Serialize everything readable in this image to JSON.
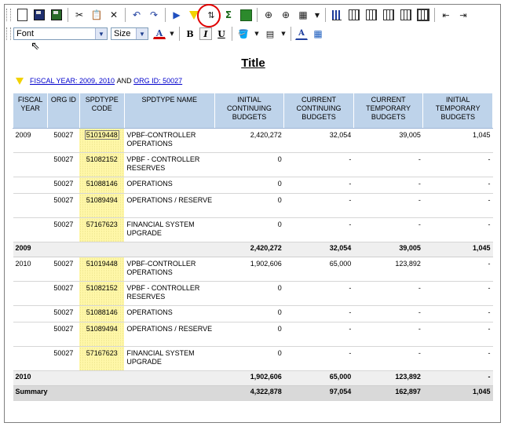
{
  "toolbar": {
    "tools": [
      "new",
      "save",
      "save-all",
      "cut",
      "paste",
      "delete",
      "undo",
      "redo",
      "run",
      "filter",
      "sort",
      "sum",
      "grid",
      "insert-row",
      "insert-col",
      "more",
      "chart",
      "table-a",
      "table-b",
      "table-c",
      "table-d",
      "table-e",
      "col-left",
      "col-right"
    ]
  },
  "format_bar": {
    "font_value": "Font",
    "size_value": "Size",
    "color_label": "A",
    "bold_label": "B",
    "italic_label": "I",
    "underline_label": "U",
    "aa_label": "A"
  },
  "report": {
    "title": "Title",
    "filter": {
      "fiscal_year": "FISCAL YEAR: 2009, 2010",
      "and": "AND",
      "org_id": "ORG ID: 50027"
    },
    "columns": [
      "FISCAL YEAR",
      "ORG ID",
      "SPDTYPE CODE",
      "SPDTYPE NAME",
      "INITIAL CONTINUING BUDGETS",
      "CURRENT CONTINUING BUDGETS",
      "CURRENT TEMPORARY BUDGETS",
      "INITIAL TEMPORARY BUDGETS"
    ],
    "groups": [
      {
        "year": "2009",
        "rows": [
          {
            "org": "50027",
            "code": "51019448",
            "name": "VPBF-CONTROLLER OPERATIONS",
            "icb": "2,420,272",
            "ccb": "32,054",
            "ctb": "39,005",
            "itb": "1,045"
          },
          {
            "org": "50027",
            "code": "51082152",
            "name": "VPBF - CONTROLLER RESERVES",
            "icb": "0",
            "ccb": "-",
            "ctb": "-",
            "itb": "-"
          },
          {
            "org": "50027",
            "code": "51088146",
            "name": "OPERATIONS",
            "icb": "0",
            "ccb": "-",
            "ctb": "-",
            "itb": "-"
          },
          {
            "org": "50027",
            "code": "51089494",
            "name": "OPERATIONS / RESERVE",
            "icb": "0",
            "ccb": "-",
            "ctb": "-",
            "itb": "-"
          },
          {
            "org": "50027",
            "code": "57167623",
            "name": "FINANCIAL SYSTEM UPGRADE",
            "icb": "0",
            "ccb": "-",
            "ctb": "-",
            "itb": "-"
          }
        ],
        "subtotal": {
          "label": "2009",
          "icb": "2,420,272",
          "ccb": "32,054",
          "ctb": "39,005",
          "itb": "1,045"
        }
      },
      {
        "year": "2010",
        "rows": [
          {
            "org": "50027",
            "code": "51019448",
            "name": "VPBF-CONTROLLER OPERATIONS",
            "icb": "1,902,606",
            "ccb": "65,000",
            "ctb": "123,892",
            "itb": "-"
          },
          {
            "org": "50027",
            "code": "51082152",
            "name": "VPBF - CONTROLLER RESERVES",
            "icb": "0",
            "ccb": "-",
            "ctb": "-",
            "itb": "-"
          },
          {
            "org": "50027",
            "code": "51088146",
            "name": "OPERATIONS",
            "icb": "0",
            "ccb": "-",
            "ctb": "-",
            "itb": "-"
          },
          {
            "org": "50027",
            "code": "51089494",
            "name": "OPERATIONS / RESERVE",
            "icb": "0",
            "ccb": "-",
            "ctb": "-",
            "itb": "-"
          },
          {
            "org": "50027",
            "code": "57167623",
            "name": "FINANCIAL SYSTEM UPGRADE",
            "icb": "0",
            "ccb": "-",
            "ctb": "-",
            "itb": "-"
          }
        ],
        "subtotal": {
          "label": "2010",
          "icb": "1,902,606",
          "ccb": "65,000",
          "ctb": "123,892",
          "itb": "-"
        }
      }
    ],
    "summary": {
      "label": "Summary",
      "icb": "4,322,878",
      "ccb": "97,054",
      "ctb": "162,897",
      "itb": "1,045"
    }
  }
}
